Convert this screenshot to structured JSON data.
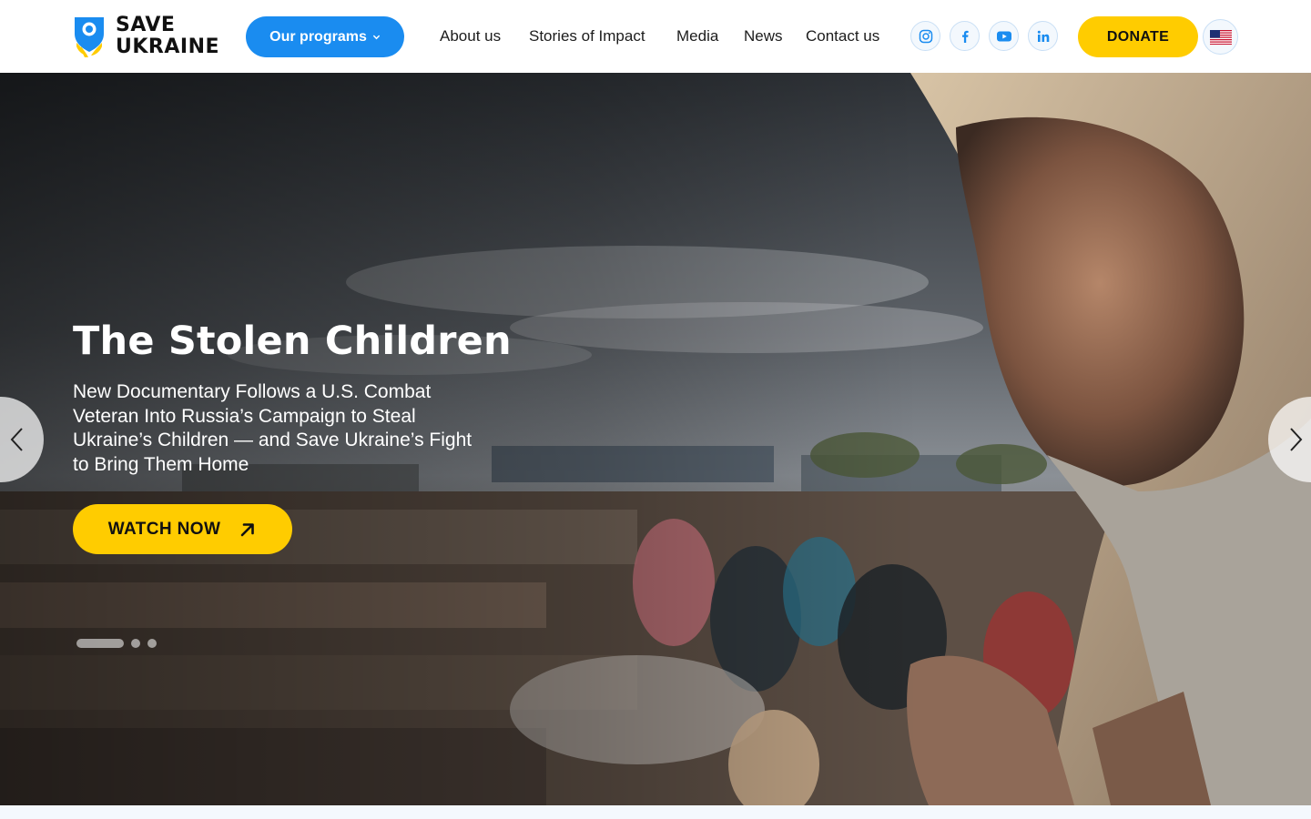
{
  "brand": {
    "line1": "SAVE",
    "line2": "UKRAINE",
    "colors": {
      "blue": "#1a8cf0",
      "yellow": "#ffcc00"
    }
  },
  "header": {
    "programs_label": "Our programs",
    "nav": [
      {
        "label": "About us"
      },
      {
        "label": "Stories of Impact"
      },
      {
        "label": "Media"
      },
      {
        "label": "News"
      },
      {
        "label": "Contact us"
      }
    ],
    "social": [
      "instagram-icon",
      "facebook-icon",
      "youtube-icon",
      "linkedin-icon"
    ],
    "donate_label": "DONATE",
    "language": "us-flag-icon"
  },
  "hero": {
    "title": "The Stolen Children",
    "subtitle": "New Documentary Follows a U.S. Combat Veteran Into Russia’s Campaign to Steal Ukraine’s Children — and Save Ukraine’s Fight to Bring Them Home",
    "cta_label": "WATCH NOW",
    "slides_total": 3,
    "active_slide": 1
  }
}
